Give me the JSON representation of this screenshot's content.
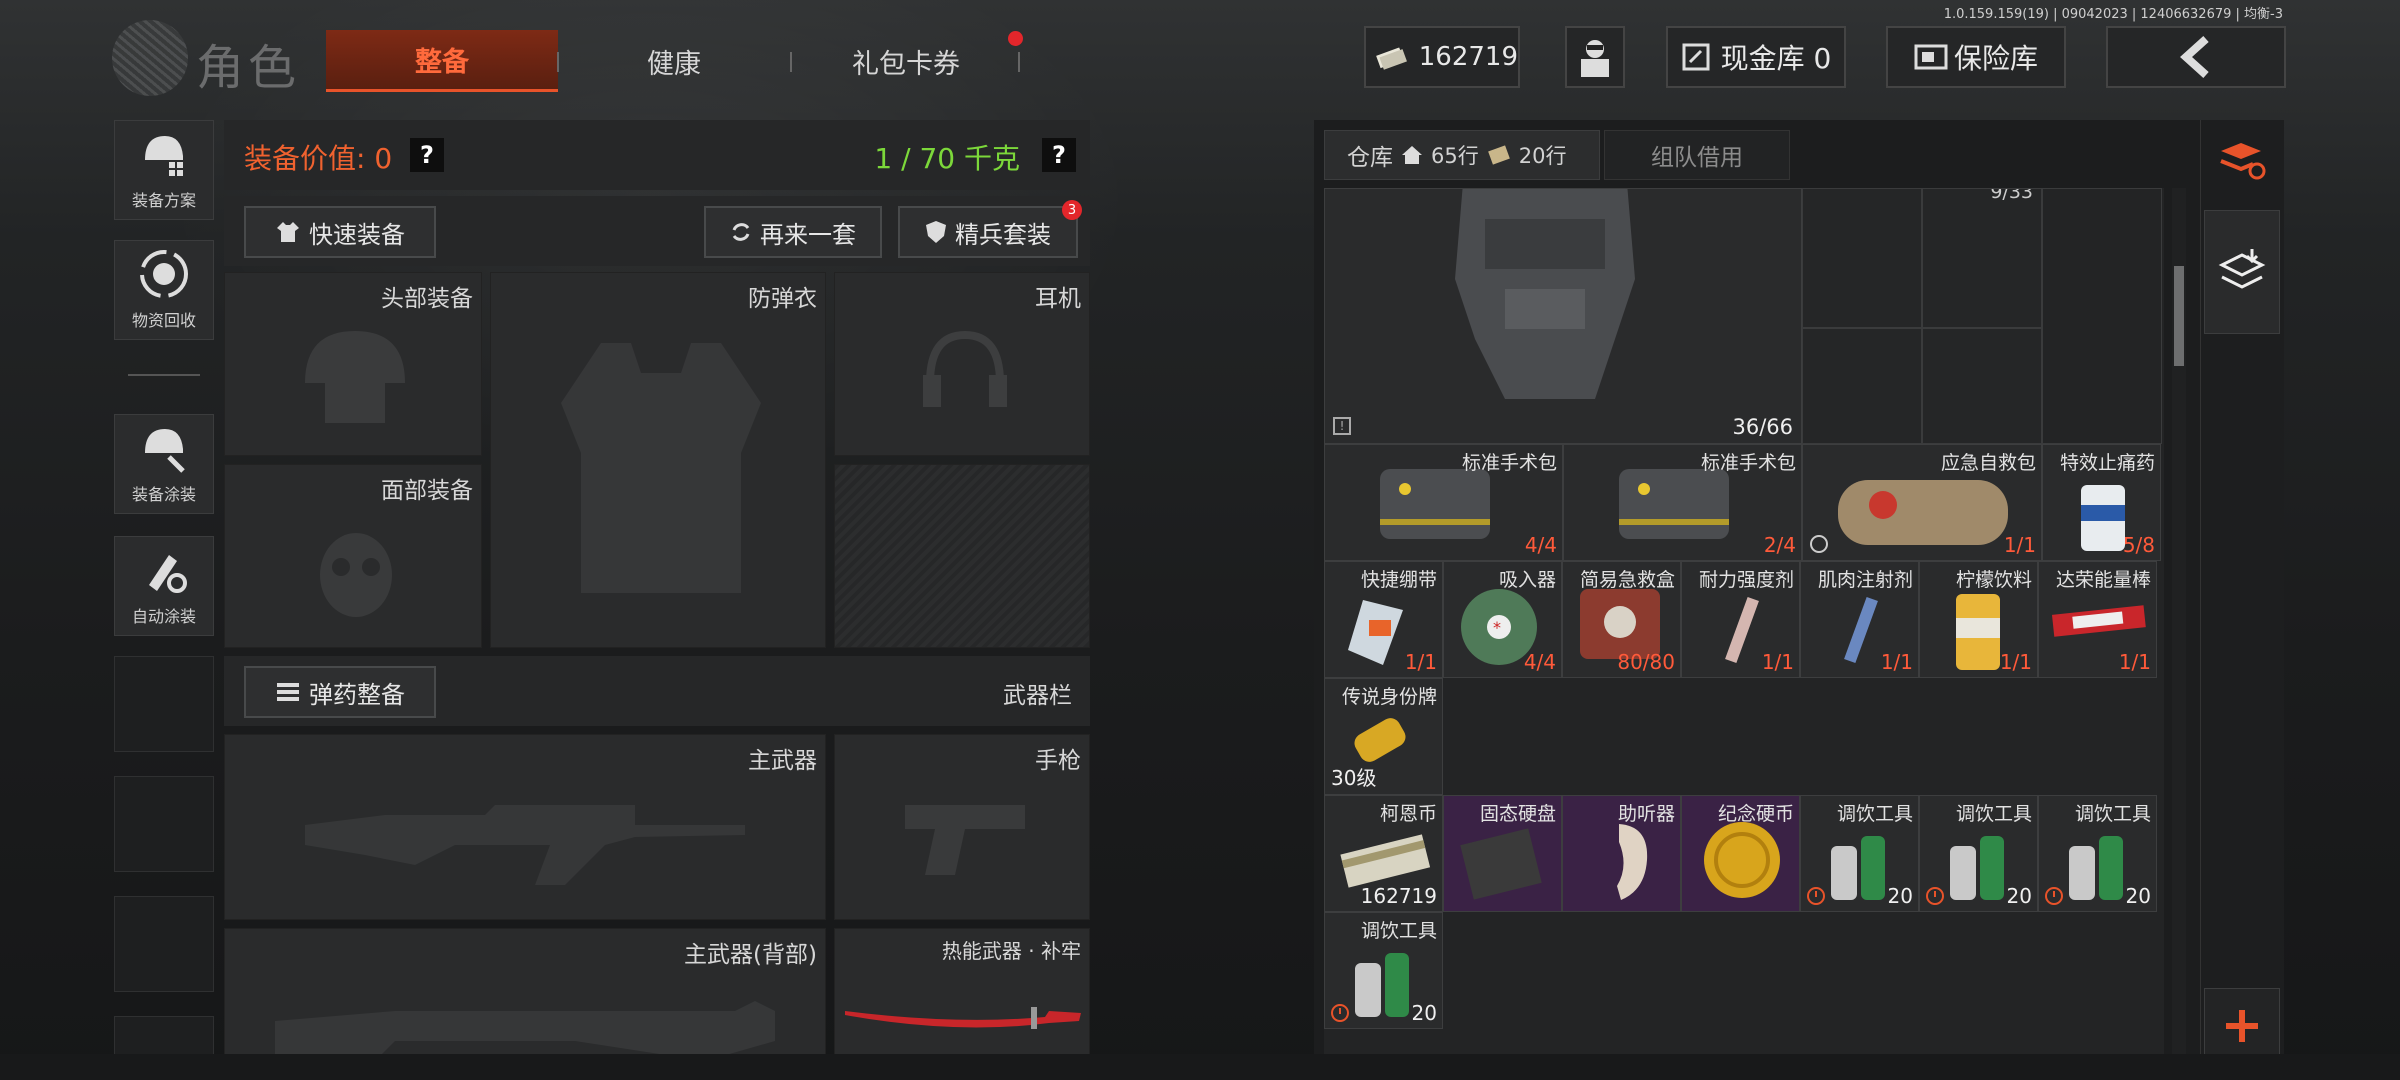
{
  "version": "1.0.159.159(19) | 09042023 | 12406632679 | 均衡-3",
  "header": {
    "title": "角色",
    "tabs": [
      {
        "label": "整备",
        "active": true
      },
      {
        "label": "健康",
        "active": false
      },
      {
        "label": "礼包卡券",
        "active": false,
        "has_notification": true
      }
    ],
    "currency_value": "162719",
    "cash_vault_label": "现金库 0",
    "insurance_label": "保险库"
  },
  "sidebar": {
    "items": [
      {
        "label": "装备方案",
        "icon": "helmet-plan-icon"
      },
      {
        "label": "物资回收",
        "icon": "recycle-icon"
      },
      {
        "label": "装备涂装",
        "icon": "paint-helmet-icon"
      },
      {
        "label": "自动涂装",
        "icon": "auto-paint-icon"
      }
    ]
  },
  "equipment": {
    "value_label": "装备价值: 0",
    "weight_label": "1 / 70 千克",
    "quick_equip": "快速装备",
    "again_label": "再来一套",
    "elite_label": "精兵套装",
    "elite_badge": "3",
    "slots": {
      "head": "头部装备",
      "armor": "防弹衣",
      "headset": "耳机",
      "face": "面部装备",
      "weapon_bar": "武器栏",
      "primary": "主武器",
      "pistol": "手枪",
      "primary_back": "主武器(背部)",
      "melee": "热能武器 · 补牢"
    },
    "ammo_button": "弹药整备"
  },
  "inventory": {
    "tab_warehouse": "仓库",
    "rows_a": "65行",
    "rows_b": "20行",
    "tab_team": "组队借用",
    "top_partial_count": "9/33",
    "vest_count": "36/66",
    "items": [
      {
        "name": "标准手术包",
        "qty": "4/4"
      },
      {
        "name": "标准手术包",
        "qty": "2/4"
      },
      {
        "name": "应急自救包",
        "qty": "1/1"
      },
      {
        "name": "特效止痛药",
        "qty": "5/8"
      },
      {
        "name": "快捷绷带",
        "qty": "1/1"
      },
      {
        "name": "吸入器",
        "qty": "4/4"
      },
      {
        "name": "简易急救盒",
        "qty": "80/80"
      },
      {
        "name": "耐力强度剂",
        "qty": "1/1"
      },
      {
        "name": "肌肉注射剂",
        "qty": "1/1"
      },
      {
        "name": "柠檬饮料",
        "qty": "1/1"
      },
      {
        "name": "达荣能量棒",
        "qty": "1/1"
      },
      {
        "name": "传说身份牌",
        "qty": "30级"
      },
      {
        "name": "柯恩币",
        "qty": "162719"
      },
      {
        "name": "固态硬盘",
        "qty": ""
      },
      {
        "name": "助听器",
        "qty": ""
      },
      {
        "name": "纪念硬币",
        "qty": ""
      },
      {
        "name": "调饮工具",
        "qty": "20"
      },
      {
        "name": "调饮工具",
        "qty": "20"
      },
      {
        "name": "调饮工具",
        "qty": "20"
      },
      {
        "name": "调饮工具",
        "qty": "20"
      }
    ]
  }
}
